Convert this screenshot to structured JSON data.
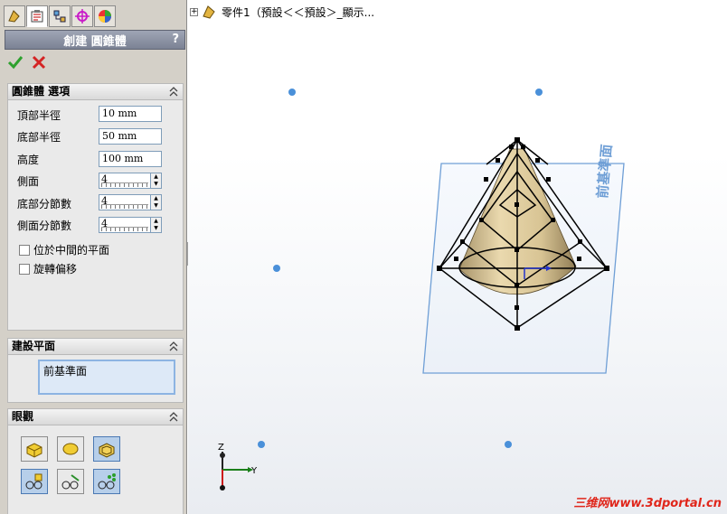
{
  "panel": {
    "title": "創建 圓錐體",
    "help": "?",
    "tabs": [
      "feature-manager-icon",
      "property-manager-icon",
      "configuration-manager-icon",
      "dimxpert-icon",
      "display-manager-icon"
    ]
  },
  "options": {
    "header": "圓錐體 選項",
    "fields": [
      {
        "label": "頂部半徑",
        "value": "10 mm"
      },
      {
        "label": "底部半徑",
        "value": "50 mm"
      },
      {
        "label": "高度",
        "value": "100 mm"
      }
    ],
    "spinners": [
      {
        "label": "側面",
        "value": "4"
      },
      {
        "label": "底部分節數",
        "value": "4"
      },
      {
        "label": "側面分節數",
        "value": "4"
      }
    ],
    "checkboxes": [
      {
        "label": "位於中間的平面",
        "checked": false
      },
      {
        "label": "旋轉偏移",
        "checked": false
      }
    ]
  },
  "plane": {
    "header": "建設平面",
    "selected": "前基準面"
  },
  "display": {
    "header": "眼觀",
    "buttons": [
      "shaded-box-icon",
      "ellipsoid-icon",
      "wireframe-box-icon",
      "glasses-plane-icon",
      "glasses-line-icon",
      "glasses-points-icon"
    ]
  },
  "viewport": {
    "tree_item": "零件1（預設＜＜預設＞_顯示...",
    "plane_label": "前基準面",
    "triad": {
      "y": "Y",
      "z": "Z"
    },
    "watermark": "三维网www.3dportal.cn"
  },
  "colors": {
    "cone": "#d9c79a",
    "plane": "#6f9fd6",
    "accent": "#e0261b"
  }
}
